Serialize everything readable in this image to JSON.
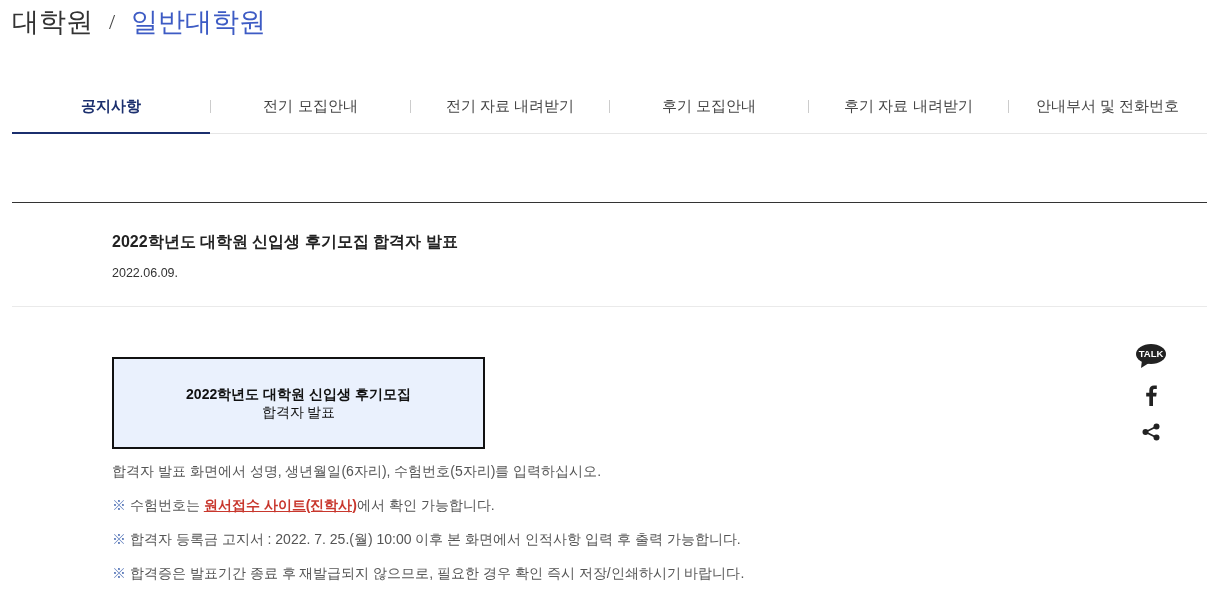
{
  "breadcrumb": {
    "parent": "대학원",
    "separator": "/",
    "current": "일반대학원"
  },
  "tabs": [
    {
      "label": "공지사항",
      "selected": true
    },
    {
      "label": "전기 모집안내",
      "selected": false
    },
    {
      "label": "전기 자료 내려받기",
      "selected": false
    },
    {
      "label": "후기 모집안내",
      "selected": false
    },
    {
      "label": "후기 자료 내려받기",
      "selected": false
    },
    {
      "label": "안내부서 및 전화번호",
      "selected": false
    }
  ],
  "post": {
    "title": "2022학년도 대학원 신입생 후기모집 합격자 발표",
    "date": "2022.06.09."
  },
  "banner": {
    "title": "2022학년도 대학원 신입생 후기모집",
    "subtitle": "합격자 발표"
  },
  "paragraphs": [
    {
      "kind": "text",
      "text": "합격자 발표 화면에서 성명, 생년월일(6자리), 수험번호(5자리)를 입력하십시오."
    },
    {
      "kind": "note_link",
      "mark": "※",
      "before": "수험번호는 ",
      "link": "원서접수 사이트(진학사)",
      "after": "에서 확인 가능합니다."
    },
    {
      "kind": "note",
      "mark": "※",
      "text": "합격자 등록금 고지서 : 2022. 7. 25.(월) 10:00 이후 본 화면에서 인적사항 입력 후 출력 가능합니다."
    },
    {
      "kind": "note",
      "mark": "※",
      "text": "합격증은 발표기간 종료 후 재발급되지 않으므로, 필요한 경우 확인 즉시 저장/인쇄하시기 바랍니다."
    }
  ],
  "share": {
    "talk_label": "TALK"
  }
}
